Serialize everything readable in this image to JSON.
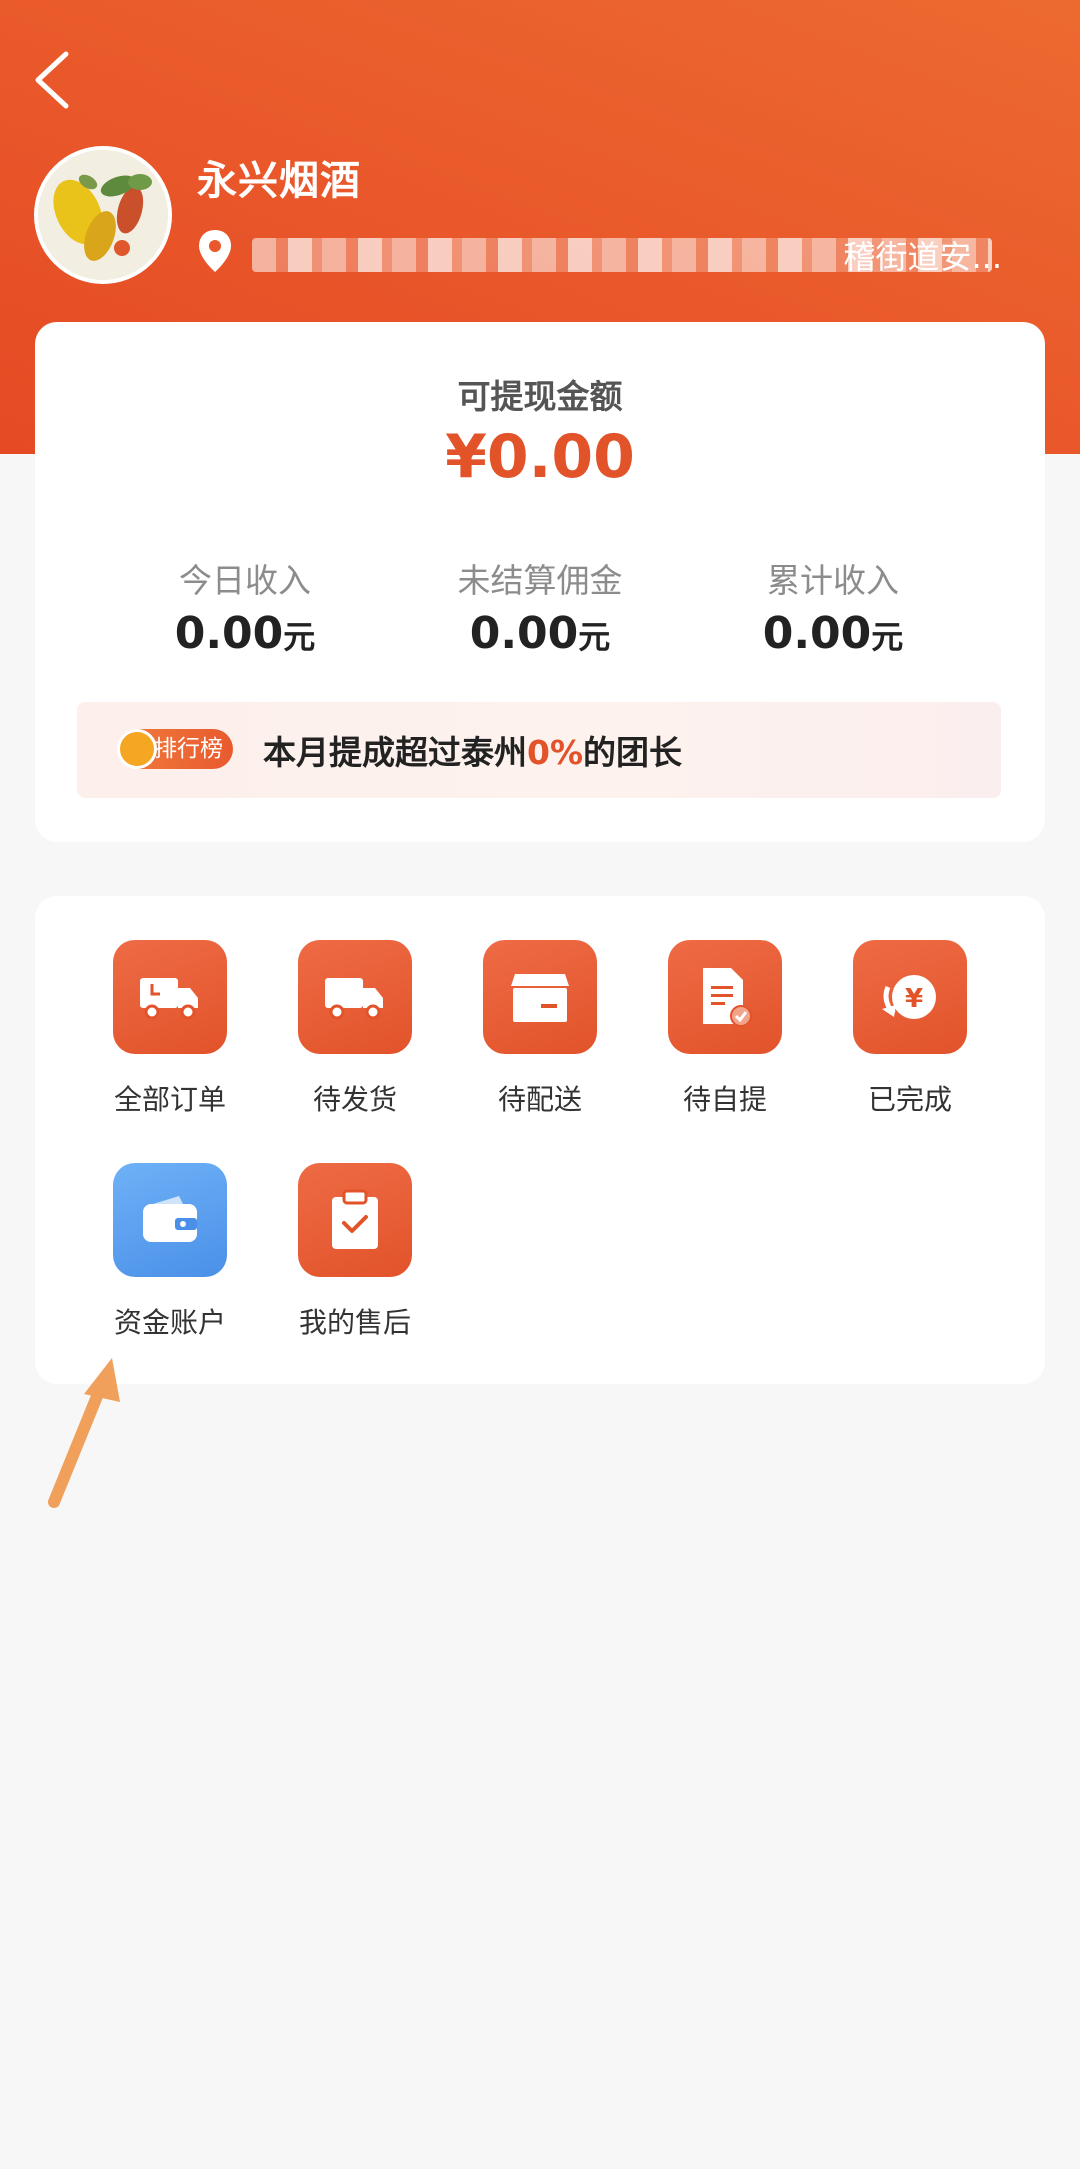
{
  "header": {
    "shop_name": "永兴烟酒",
    "address_visible": "稽街道安..."
  },
  "balance": {
    "label": "可提现金额",
    "value": "¥0.00"
  },
  "stats": [
    {
      "label": "今日收入",
      "value": "0.00",
      "unit": "元"
    },
    {
      "label": "未结算佣金",
      "value": "0.00",
      "unit": "元"
    },
    {
      "label": "累计收入",
      "value": "0.00",
      "unit": "元"
    }
  ],
  "ranking": {
    "badge": "排行榜",
    "text_before": "本月提成超过泰州",
    "percent": "0%",
    "text_after": "的团长"
  },
  "menu": [
    {
      "label": "全部订单",
      "icon": "truck-clock-icon"
    },
    {
      "label": "待发货",
      "icon": "truck-icon"
    },
    {
      "label": "待配送",
      "icon": "box-icon"
    },
    {
      "label": "待自提",
      "icon": "document-check-icon"
    },
    {
      "label": "已完成",
      "icon": "yen-coin-icon"
    },
    {
      "label": "资金账户",
      "icon": "wallet-icon"
    },
    {
      "label": "我的售后",
      "icon": "clipboard-check-icon"
    }
  ],
  "colors": {
    "accent": "#e2532a",
    "header_gradient_start": "#ec6a30",
    "wallet_blue": "#4a90e8",
    "annotation_arrow": "#f0a05a"
  }
}
